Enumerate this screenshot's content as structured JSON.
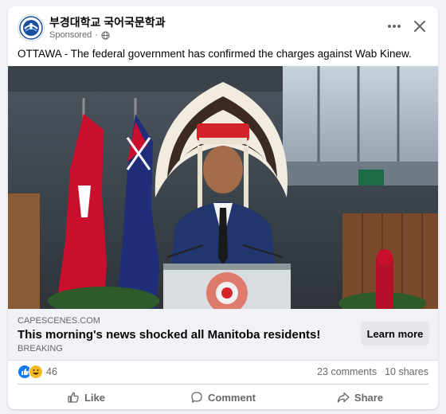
{
  "post": {
    "page_name": "부경대학교 국어국문학과",
    "sponsored_label": "Sponsored",
    "privacy_icon": "globe-icon",
    "more_icon": "more-horizontal-icon",
    "close_icon": "close-icon",
    "text": "OTTAWA - The federal government has confirmed the charges against Wab Kinew."
  },
  "link_preview": {
    "domain": "CAPESCENES.COM",
    "title": "This morning's news shocked all Manitoba residents!",
    "subtitle": "BREAKING",
    "cta_label": "Learn more"
  },
  "stats": {
    "reaction_icons": [
      "like-icon",
      "haha-icon"
    ],
    "reaction_count": "46",
    "comments": "23 comments",
    "shares": "10 shares"
  },
  "actions": {
    "like": {
      "label": "Like",
      "icon": "thumbs-up-icon"
    },
    "comment": {
      "label": "Comment",
      "icon": "comment-bubble-icon"
    },
    "share": {
      "label": "Share",
      "icon": "share-arrow-icon"
    }
  },
  "colors": {
    "like_blue": "#1877f2",
    "haha_yellow": "#f7b928",
    "secondary_text": "#65676b",
    "link_background": "#f0f2f5"
  }
}
